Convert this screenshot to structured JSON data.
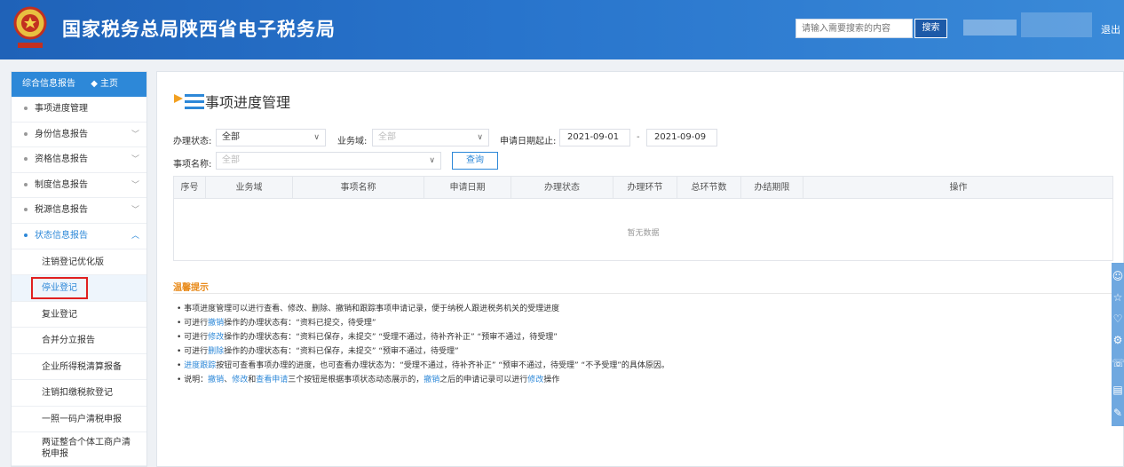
{
  "header": {
    "site_title": "国家税务总局陕西省电子税务局",
    "search_placeholder": "请输入需要搜索的内容",
    "search_button": "搜索",
    "logout": "退出"
  },
  "sidebar": {
    "head_label": "综合信息报告",
    "home_label": "◆ 主页",
    "items": [
      {
        "label": "事项进度管理"
      },
      {
        "label": "身份信息报告"
      },
      {
        "label": "资格信息报告"
      },
      {
        "label": "制度信息报告"
      },
      {
        "label": "税源信息报告"
      },
      {
        "label": "状态信息报告"
      }
    ],
    "sub_items": [
      {
        "label": "注销登记优化版"
      },
      {
        "label": "停业登记"
      },
      {
        "label": "复业登记"
      },
      {
        "label": "合并分立报告"
      },
      {
        "label": "企业所得税清算报备"
      },
      {
        "label": "注销扣缴税款登记"
      },
      {
        "label": "一照一码户清税申报"
      },
      {
        "label": "两证整合个体工商户清税申报"
      }
    ]
  },
  "main": {
    "page_title": "事项进度管理",
    "filters": {
      "status_label": "办理状态:",
      "status_value": "全部",
      "domain_label": "业务域:",
      "domain_value": "全部",
      "date_label": "申请日期起止:",
      "date_from": "2021-09-01",
      "date_sep": "-",
      "date_to": "2021-09-09",
      "name_label": "事项名称:",
      "name_value": "全部",
      "query_button": "查询"
    },
    "table": {
      "columns": [
        "序号",
        "业务域",
        "事项名称",
        "申请日期",
        "办理状态",
        "办理环节",
        "总环节数",
        "办结期限",
        "操作"
      ],
      "empty_text": "暂无数据"
    },
    "tips": {
      "title": "温馨提示",
      "lines": [
        {
          "pre": "• 事项进度管理可以进行查看、修改、删除、撤销和跟踪事项申请记录，便于纳税人跟进税务机关的受理进度",
          "key": "",
          "post": ""
        },
        {
          "pre": "• 可进行",
          "key": "撤销",
          "post": "操作的办理状态有：“资料已提交，待受理”"
        },
        {
          "pre": "• 可进行",
          "key": "修改",
          "post": "操作的办理状态有：“资料已保存，未提交”  “受理不通过，待补齐补正”  “预审不通过，待受理”"
        },
        {
          "pre": "• 可进行",
          "key": "删除",
          "post": "操作的办理状态有：“资料已保存，未提交”  “预审不通过，待受理”"
        },
        {
          "pre": "• ",
          "key": "进度跟踪",
          "post": "按钮可查看事项办理的进度，也可查看办理状态为：“受理不通过，待补齐补正”  “预审不通过，待受理”  “不予受理”的具体原因。"
        }
      ],
      "last_line": {
        "p1": "• 说明：",
        "k1": "撤销",
        "p2": "、",
        "k2": "修改",
        "p3": "和",
        "k3": "查看申请",
        "p4": "三个按钮是根据事项状态动态展示的，",
        "k4": "撤销",
        "p5": "之后的申请记录可以进行",
        "k5": "修改",
        "p6": "操作"
      }
    }
  },
  "colors": {
    "header_blue": "#2874cc",
    "accent_blue": "#2d88d8",
    "tip_orange": "#e88a1a",
    "highlight_red": "#e02020"
  }
}
